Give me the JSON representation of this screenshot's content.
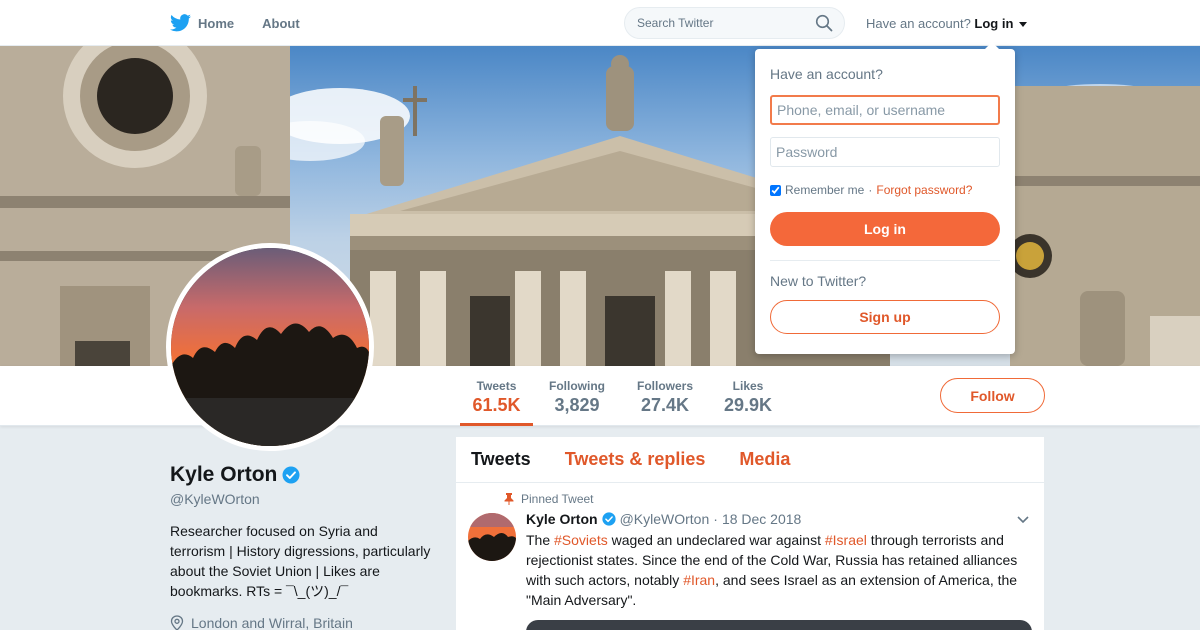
{
  "nav": {
    "home_label": "Home",
    "about_label": "About",
    "search_placeholder": "Search Twitter",
    "have_account": "Have an account?",
    "login_label": "Log in"
  },
  "profile": {
    "name": "Kyle Orton",
    "handle": "@KyleWOrton",
    "bio": "Researcher focused on Syria and terrorism | History digressions, particularly about the Soviet Union | Likes are bookmarks. RTs = ¯\\_(ツ)_/¯",
    "location": "London and Wirral, Britain",
    "verified": true
  },
  "stats": [
    {
      "label": "Tweets",
      "value": "61.5K",
      "active": true
    },
    {
      "label": "Following",
      "value": "3,829",
      "active": false
    },
    {
      "label": "Followers",
      "value": "27.4K",
      "active": false
    },
    {
      "label": "Likes",
      "value": "29.9K",
      "active": false
    }
  ],
  "follow_label": "Follow",
  "tabs": [
    {
      "label": "Tweets",
      "active": true
    },
    {
      "label": "Tweets & replies",
      "active": false
    },
    {
      "label": "Media",
      "active": false
    }
  ],
  "tweet": {
    "pinned_label": "Pinned Tweet",
    "author": "Kyle Orton",
    "handle": "@KyleWOrton",
    "separator": "·",
    "date": "18 Dec 2018",
    "text_1": "The ",
    "tag_1": "#Soviets",
    "text_2": " waged an undeclared war against ",
    "tag_2": "#Israel",
    "text_3": " through terrorists and rejectionist states. Since the end of the Cold War, Russia has retained alliances with such actors, notably ",
    "tag_3": "#Iran",
    "text_4": ", and sees Israel as an extension of America, the \"Main Adversary\"."
  },
  "login_dropdown": {
    "title": "Have an account?",
    "username_placeholder": "Phone, email, or username",
    "password_placeholder": "Password",
    "remember_label": "Remember me",
    "separator": "·",
    "forgot_label": "Forgot password?",
    "login_button": "Log in",
    "new_label": "New to Twitter?",
    "signup_button": "Sign up",
    "remember_checked": true
  },
  "colors": {
    "accent": "#e0582a",
    "verified": "#1da1f2",
    "muted": "#657786"
  }
}
